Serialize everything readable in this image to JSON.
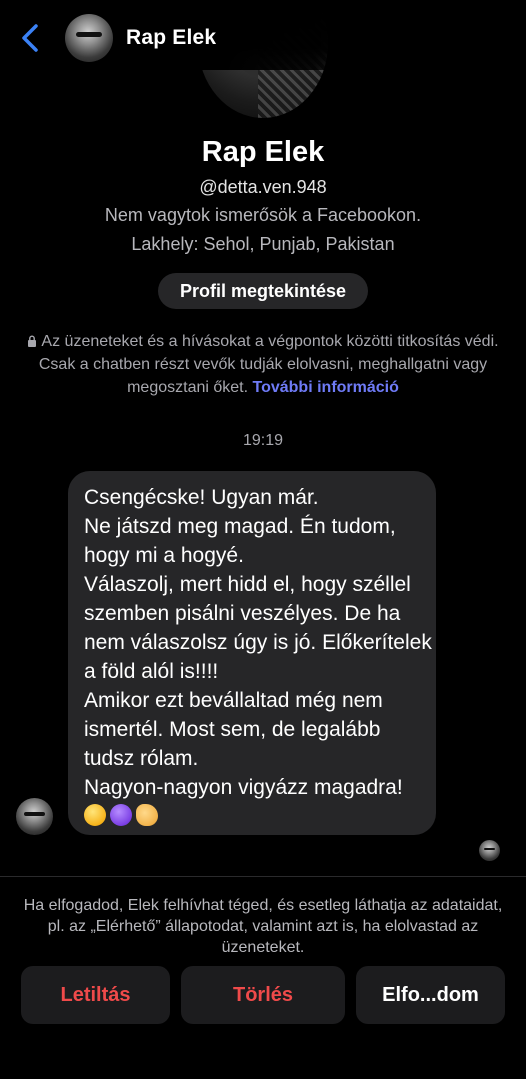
{
  "header": {
    "back_icon": "chevron-left-icon",
    "contact_name": "Rap Elek"
  },
  "profile": {
    "name": "Rap Elek",
    "handle": "@detta.ven.948",
    "friend_status": "Nem vagytok ismerősök a Facebookon.",
    "location": "Lakhely: Sehol, Punjab, Pakistan",
    "view_profile_label": "Profil megtekintése"
  },
  "encryption_notice": {
    "icon": "lock-icon",
    "text": "Az üzeneteket és a hívásokat a végpontok közötti titkosítás védi. Csak a chatben részt vevők tudják elolvasni, meghallgatni vagy megosztani őket.",
    "link": "További információ"
  },
  "conversation": {
    "timestamp": "19:19",
    "message_text": "Csengécske! Ugyan már.\nNe játszd meg magad. Én tudom, hogy mi a hogyé.\nVálaszolj, mert hidd el, hogy széllel szemben pisálni veszélyes. De ha nem válaszolsz úgy is jó. Előkerítelek a föld alól is!!!!\nAmikor ezt bevállaltad még nem ismertél. Most sem, de legalább tudsz rólam.\nNagyon-nagyon vigyázz magadra!",
    "message_emojis": [
      "winking-face-icon",
      "smiling-devil-icon",
      "flexed-biceps-icon"
    ]
  },
  "request_footer": {
    "note": "Ha elfogadod, Elek felhívhat téged, és esetleg láthatja az adataidat, pl. az „Elérhető” állapotodat, valamint azt is, ha elolvastad az üzeneteket.",
    "block_label": "Letiltás",
    "delete_label": "Törlés",
    "accept_label": "Elfo...dom"
  },
  "colors": {
    "background": "#000000",
    "bubble": "#262628",
    "link": "#6f7bf7",
    "danger": "#ef4a4a",
    "back_chevron": "#3b82f6"
  }
}
